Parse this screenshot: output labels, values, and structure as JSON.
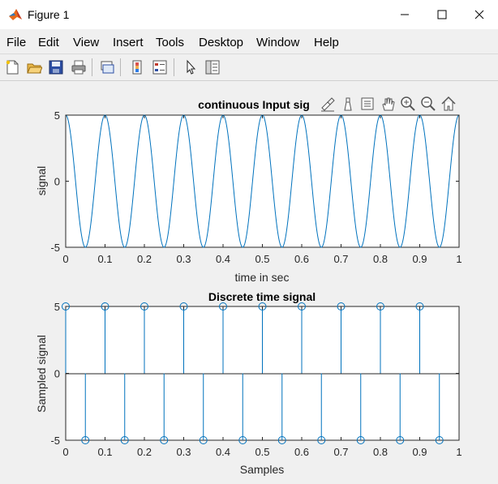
{
  "window": {
    "title": "Figure 1",
    "app_icon": "matlab-icon",
    "controls": [
      "minimize-icon",
      "maximize-icon",
      "close-icon"
    ]
  },
  "menu": {
    "items": [
      "File",
      "Edit",
      "View",
      "Insert",
      "Tools",
      "Desktop",
      "Window",
      "Help"
    ]
  },
  "toolbar": {
    "buttons": [
      "new-figure-icon",
      "open-file-icon",
      "save-icon",
      "print-icon",
      "link-plot-icon",
      "colorbar-icon",
      "legend-icon",
      "edit-plot-arrow-icon",
      "property-inspector-icon"
    ]
  },
  "axes_toolbar": {
    "buttons": [
      "brush-icon",
      "data-tip-icon",
      "rotate-icon",
      "pan-hand-icon",
      "zoom-in-icon",
      "zoom-out-icon",
      "home-icon"
    ]
  },
  "colors": {
    "line": "#0072bd",
    "axes_bg": "#ffffff",
    "figure_bg": "#f0f0f0"
  },
  "chart_data": [
    {
      "type": "line",
      "title": "continuous Input sig",
      "xlabel": "time in sec",
      "ylabel": "signal",
      "xlim": [
        0,
        1
      ],
      "ylim": [
        -5,
        5
      ],
      "xticks": [
        "0",
        "0.1",
        "0.2",
        "0.3",
        "0.4",
        "0.5",
        "0.6",
        "0.7",
        "0.8",
        "0.9",
        "1"
      ],
      "yticks": [
        "-5",
        "0",
        "5"
      ],
      "function": "5*cos(2*pi*10*t)",
      "grid": false
    },
    {
      "type": "stem",
      "title": "Discrete time signal",
      "xlabel": "Samples",
      "ylabel": "Sampled signal",
      "xlim": [
        0,
        1
      ],
      "ylim": [
        -5,
        5
      ],
      "xticks": [
        "0",
        "0.1",
        "0.2",
        "0.3",
        "0.4",
        "0.5",
        "0.6",
        "0.7",
        "0.8",
        "0.9",
        "1"
      ],
      "yticks": [
        "-5",
        "0",
        "5"
      ],
      "x": [
        0,
        0.05,
        0.1,
        0.15,
        0.2,
        0.25,
        0.3,
        0.35,
        0.4,
        0.45,
        0.5,
        0.55,
        0.6,
        0.65,
        0.7,
        0.75,
        0.8,
        0.85,
        0.9,
        0.95
      ],
      "y": [
        5,
        -5,
        5,
        -5,
        5,
        -5,
        5,
        -5,
        5,
        -5,
        5,
        -5,
        5,
        -5,
        5,
        -5,
        5,
        -5,
        5,
        -5
      ],
      "grid": false
    }
  ]
}
